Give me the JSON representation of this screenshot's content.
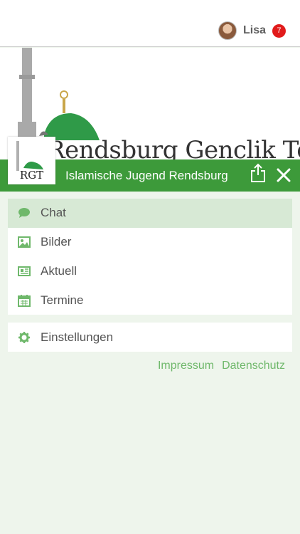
{
  "user": {
    "name": "Lisa",
    "notifications": "7"
  },
  "banner": {
    "text": "Rendsburg Genclik Teskilatı"
  },
  "header": {
    "logo_text": "RGT",
    "title": "Islamische Jugend Rendsburg"
  },
  "menu": {
    "items": [
      {
        "label": "Chat",
        "icon": "chat-icon",
        "active": true
      },
      {
        "label": "Bilder",
        "icon": "image-icon",
        "active": false
      },
      {
        "label": "Aktuell",
        "icon": "newspaper-icon",
        "active": false
      },
      {
        "label": "Termine",
        "icon": "calendar-icon",
        "active": false
      }
    ],
    "settings_label": "Einstellungen"
  },
  "footer": {
    "impressum": "Impressum",
    "datenschutz": "Datenschutz"
  },
  "colors": {
    "brand_green": "#3d9a3a",
    "active_bg": "#d7e9d5",
    "link_green": "#6fb86b",
    "badge_red": "#e11b1b",
    "icon_green": "#6fb86b"
  }
}
